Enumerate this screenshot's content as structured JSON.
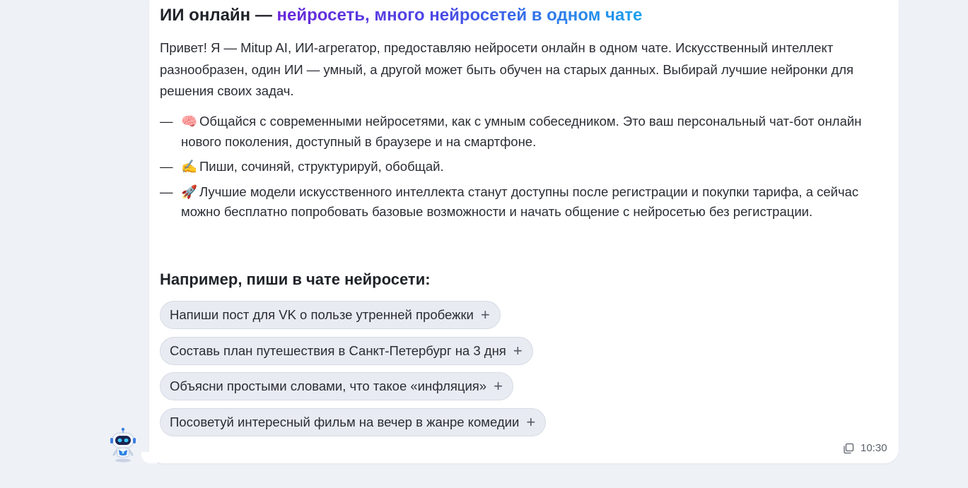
{
  "message": {
    "heading_prefix": "ИИ онлайн — ",
    "heading_accent": "нейросеть, много нейросетей в одном чате",
    "intro": "Привет! Я — Mitup AI, ИИ-агрегатор, предоставляю нейросети онлайн в одном чате. Искусственный интеллект разнообразен, один ИИ — умный, а другой может быть обучен на старых данных. Выбирай лучшие нейронки для решения своих задач.",
    "features": [
      {
        "dash": "—",
        "emoji": "🧠",
        "text": "Общайся с современными нейросетями, как с умным собеседником. Это ваш персональный чат-бот онлайн нового поколения, доступный в браузере и на смартфоне."
      },
      {
        "dash": "—",
        "emoji": "✍️",
        "text": "Пиши, сочиняй, структурируй, обобщай."
      },
      {
        "dash": "—",
        "emoji": "🚀",
        "text": "Лучшие модели искусственного интеллекта станут доступны после регистрации и покупки тарифа, а сейчас можно бесплатно попробовать базовые возможности и начать общение с нейросетью без регистрации."
      }
    ],
    "examples_heading": "Например, пиши в чате нейросети:",
    "examples": [
      {
        "label": "Напиши пост для VK о пользе утренней пробежки",
        "icon": "+"
      },
      {
        "label": "Составь план путешествия в Санкт-Петербург на 3 дня",
        "icon": "+"
      },
      {
        "label": "Объясни простыми словами, что такое «инфляция»",
        "icon": "+"
      },
      {
        "label": "Посоветуй интересный фильм на вечер в жанре комедии",
        "icon": "+"
      }
    ],
    "time": "10:30"
  },
  "icons": {
    "avatar": "robot-avatar-icon",
    "copy": "copy-icon",
    "chip": "plus-icon"
  },
  "colors": {
    "page_bg": "#eef1f6",
    "bubble_bg": "#ffffff",
    "chip_bg": "#e8ebf2",
    "gradient_start": "#6a27d9",
    "gradient_end": "#1ba2ec",
    "text": "#23262c"
  }
}
